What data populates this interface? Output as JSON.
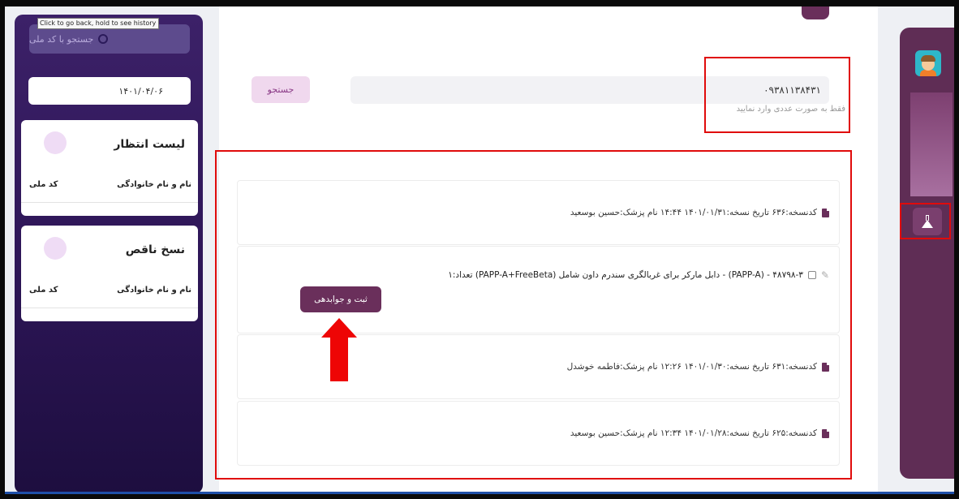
{
  "browser": {
    "tooltip": "Click to go back, hold to see history"
  },
  "left_panel": {
    "search_placeholder": "جستجو با کد ملی",
    "date_value": "۱۴۰۱/۰۴/۰۶",
    "waiting_list": {
      "title": "لیست انتظار",
      "col_name": "نام و نام خانوادگی",
      "col_id": "کد ملی"
    },
    "incomplete": {
      "title": "نسخ ناقص",
      "col_name": "نام و نام خانوادگی",
      "col_id": "کد ملی"
    }
  },
  "main": {
    "search_value": "۰۹۳۸۱۱۳۸۴۳۱",
    "search_hint": "فقط به صورت عددی وارد نمایید",
    "search_button": "جستجو",
    "prescriptions": [
      {
        "line": "کدنسخه:۶۳۶ تاریخ نسخه:۱۴۰۱/۰۱/۳۱ ۱۴:۴۴ نام پزشک:حسین بوسعید"
      },
      {
        "line": "کدنسخه:۶۳۱ تاریخ نسخه:۱۴۰۱/۰۱/۳۰ ۱۲:۲۶ نام پزشک:فاطمه خوشدل"
      },
      {
        "line": "کدنسخه:۶۲۵ تاریخ نسخه:۱۴۰۱/۰۱/۲۸ ۱۲:۳۴ نام پزشک:حسین بوسعید"
      }
    ],
    "test_item": {
      "line": "۴۸۷۹۸-۳ - (PAPP-A) - دابل مارکر برای غربالگری سندرم داون شامل (PAPP-A+FreeBeta)  تعداد:۱",
      "register_button": "ثبت و جوابدهی"
    }
  },
  "colors": {
    "accent": "#6a2f5b",
    "sidebar_dark": "#2e1658",
    "highlight_red": "#e00b0b",
    "arrow_red": "#ee0505"
  }
}
